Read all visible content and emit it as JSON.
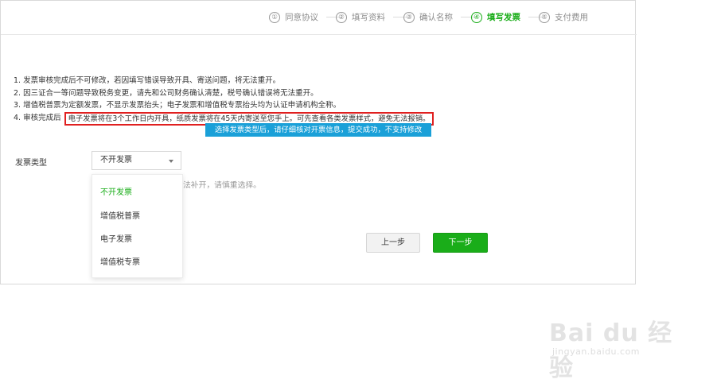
{
  "steps": [
    {
      "num": "①",
      "label": "同意协议",
      "active": false
    },
    {
      "num": "②",
      "label": "填写资料",
      "active": false
    },
    {
      "num": "③",
      "label": "确认名称",
      "active": false
    },
    {
      "num": "④",
      "label": "填写发票",
      "active": true
    },
    {
      "num": "⑤",
      "label": "支付费用",
      "active": false
    }
  ],
  "notes": {
    "line1": "1. 发票审核完成后不可修改，若因填写错误导致开具、寄送问题，将无法重开。",
    "line2": "2. 因三证合一等问题导致税务变更，请先和公司财务确认清楚，税号确认错误将无法重开。",
    "line3": "3. 增值税普票为定额发票，不显示发票抬头；电子发票和增值税专票抬头均为认证申请机构全称。",
    "line4_prefix": "4. 审核完成后",
    "line4_highlight": "电子发票将在3个工作日内开具，纸质发票将在45天内寄送至您手上。可先查看各类发票样式，避免无法报销。"
  },
  "tip_banner": "选择发票类型后，请仔细核对开票信息，提交成功，不支持修改",
  "invoice_type": {
    "label": "发票类型",
    "selected": "不开发票",
    "options": [
      "不开发票",
      "增值税普票",
      "电子发票",
      "增值税专票"
    ]
  },
  "hint_partial": "法补开，请慎重选择。",
  "buttons": {
    "prev": "上一步",
    "next": "下一步"
  },
  "watermark": {
    "logo": "Bai du 经验",
    "url": "jingyan.baidu.com"
  },
  "colors": {
    "accent": "#1aad19",
    "tip_bg": "#1aa0d8",
    "highlight_border": "#e02020"
  }
}
